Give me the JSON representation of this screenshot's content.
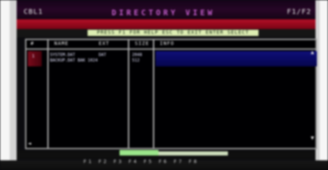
{
  "window": {
    "title_left": "CBL1",
    "title_center": "DIRECTORY VIEW",
    "title_right": "F1/F2"
  },
  "status": {
    "text": "PRESS F1 FOR HELP  ESC TO EXIT  ENTER SELECT"
  },
  "table": {
    "headers": [
      "#",
      "NAME",
      "EXT",
      "SIZE",
      "INFO"
    ],
    "rows": [
      {
        "marker": "1",
        "name": "SYSTEM.DAT",
        "ext": "DAT",
        "size": "2048",
        "line2": "BACKUP.DAT  BAK  1024",
        "size2": "512"
      }
    ]
  },
  "scroll": {
    "up": "▲",
    "down": "▼",
    "left": "◄"
  },
  "footer": {
    "keys": "F1 F2 F3 F4 F5 F6 F7 F8"
  }
}
